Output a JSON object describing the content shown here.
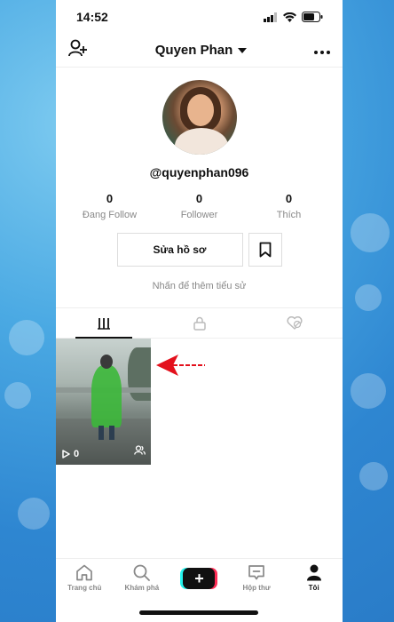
{
  "status_bar": {
    "time": "14:52"
  },
  "header": {
    "title": "Quyen Phan",
    "add_user_icon": "add-user-icon",
    "more_icon": "more-icon"
  },
  "profile": {
    "username": "@quyenphan096",
    "stats": [
      {
        "value": "0",
        "label": "Đang Follow"
      },
      {
        "value": "0",
        "label": "Follower"
      },
      {
        "value": "0",
        "label": "Thích"
      }
    ],
    "edit_button": "Sửa hồ sơ",
    "bio_placeholder": "Nhấn để thêm tiểu sử"
  },
  "tabs": [
    {
      "icon": "grid-icon",
      "active": true
    },
    {
      "icon": "lock-icon",
      "active": false
    },
    {
      "icon": "liked-hidden-icon",
      "active": false
    }
  ],
  "videos": [
    {
      "views": "0"
    }
  ],
  "bottom_nav": [
    {
      "label": "Trang chủ",
      "icon": "home-icon"
    },
    {
      "label": "Khám phá",
      "icon": "search-icon"
    },
    {
      "label": "",
      "icon": "plus-icon"
    },
    {
      "label": "Hộp thư",
      "icon": "inbox-icon"
    },
    {
      "label": "Tôi",
      "icon": "profile-icon",
      "active": true
    }
  ],
  "colors": {
    "accent_red": "#fe2c55",
    "accent_cyan": "#25f4ee",
    "arrow_red": "#e3101c"
  }
}
